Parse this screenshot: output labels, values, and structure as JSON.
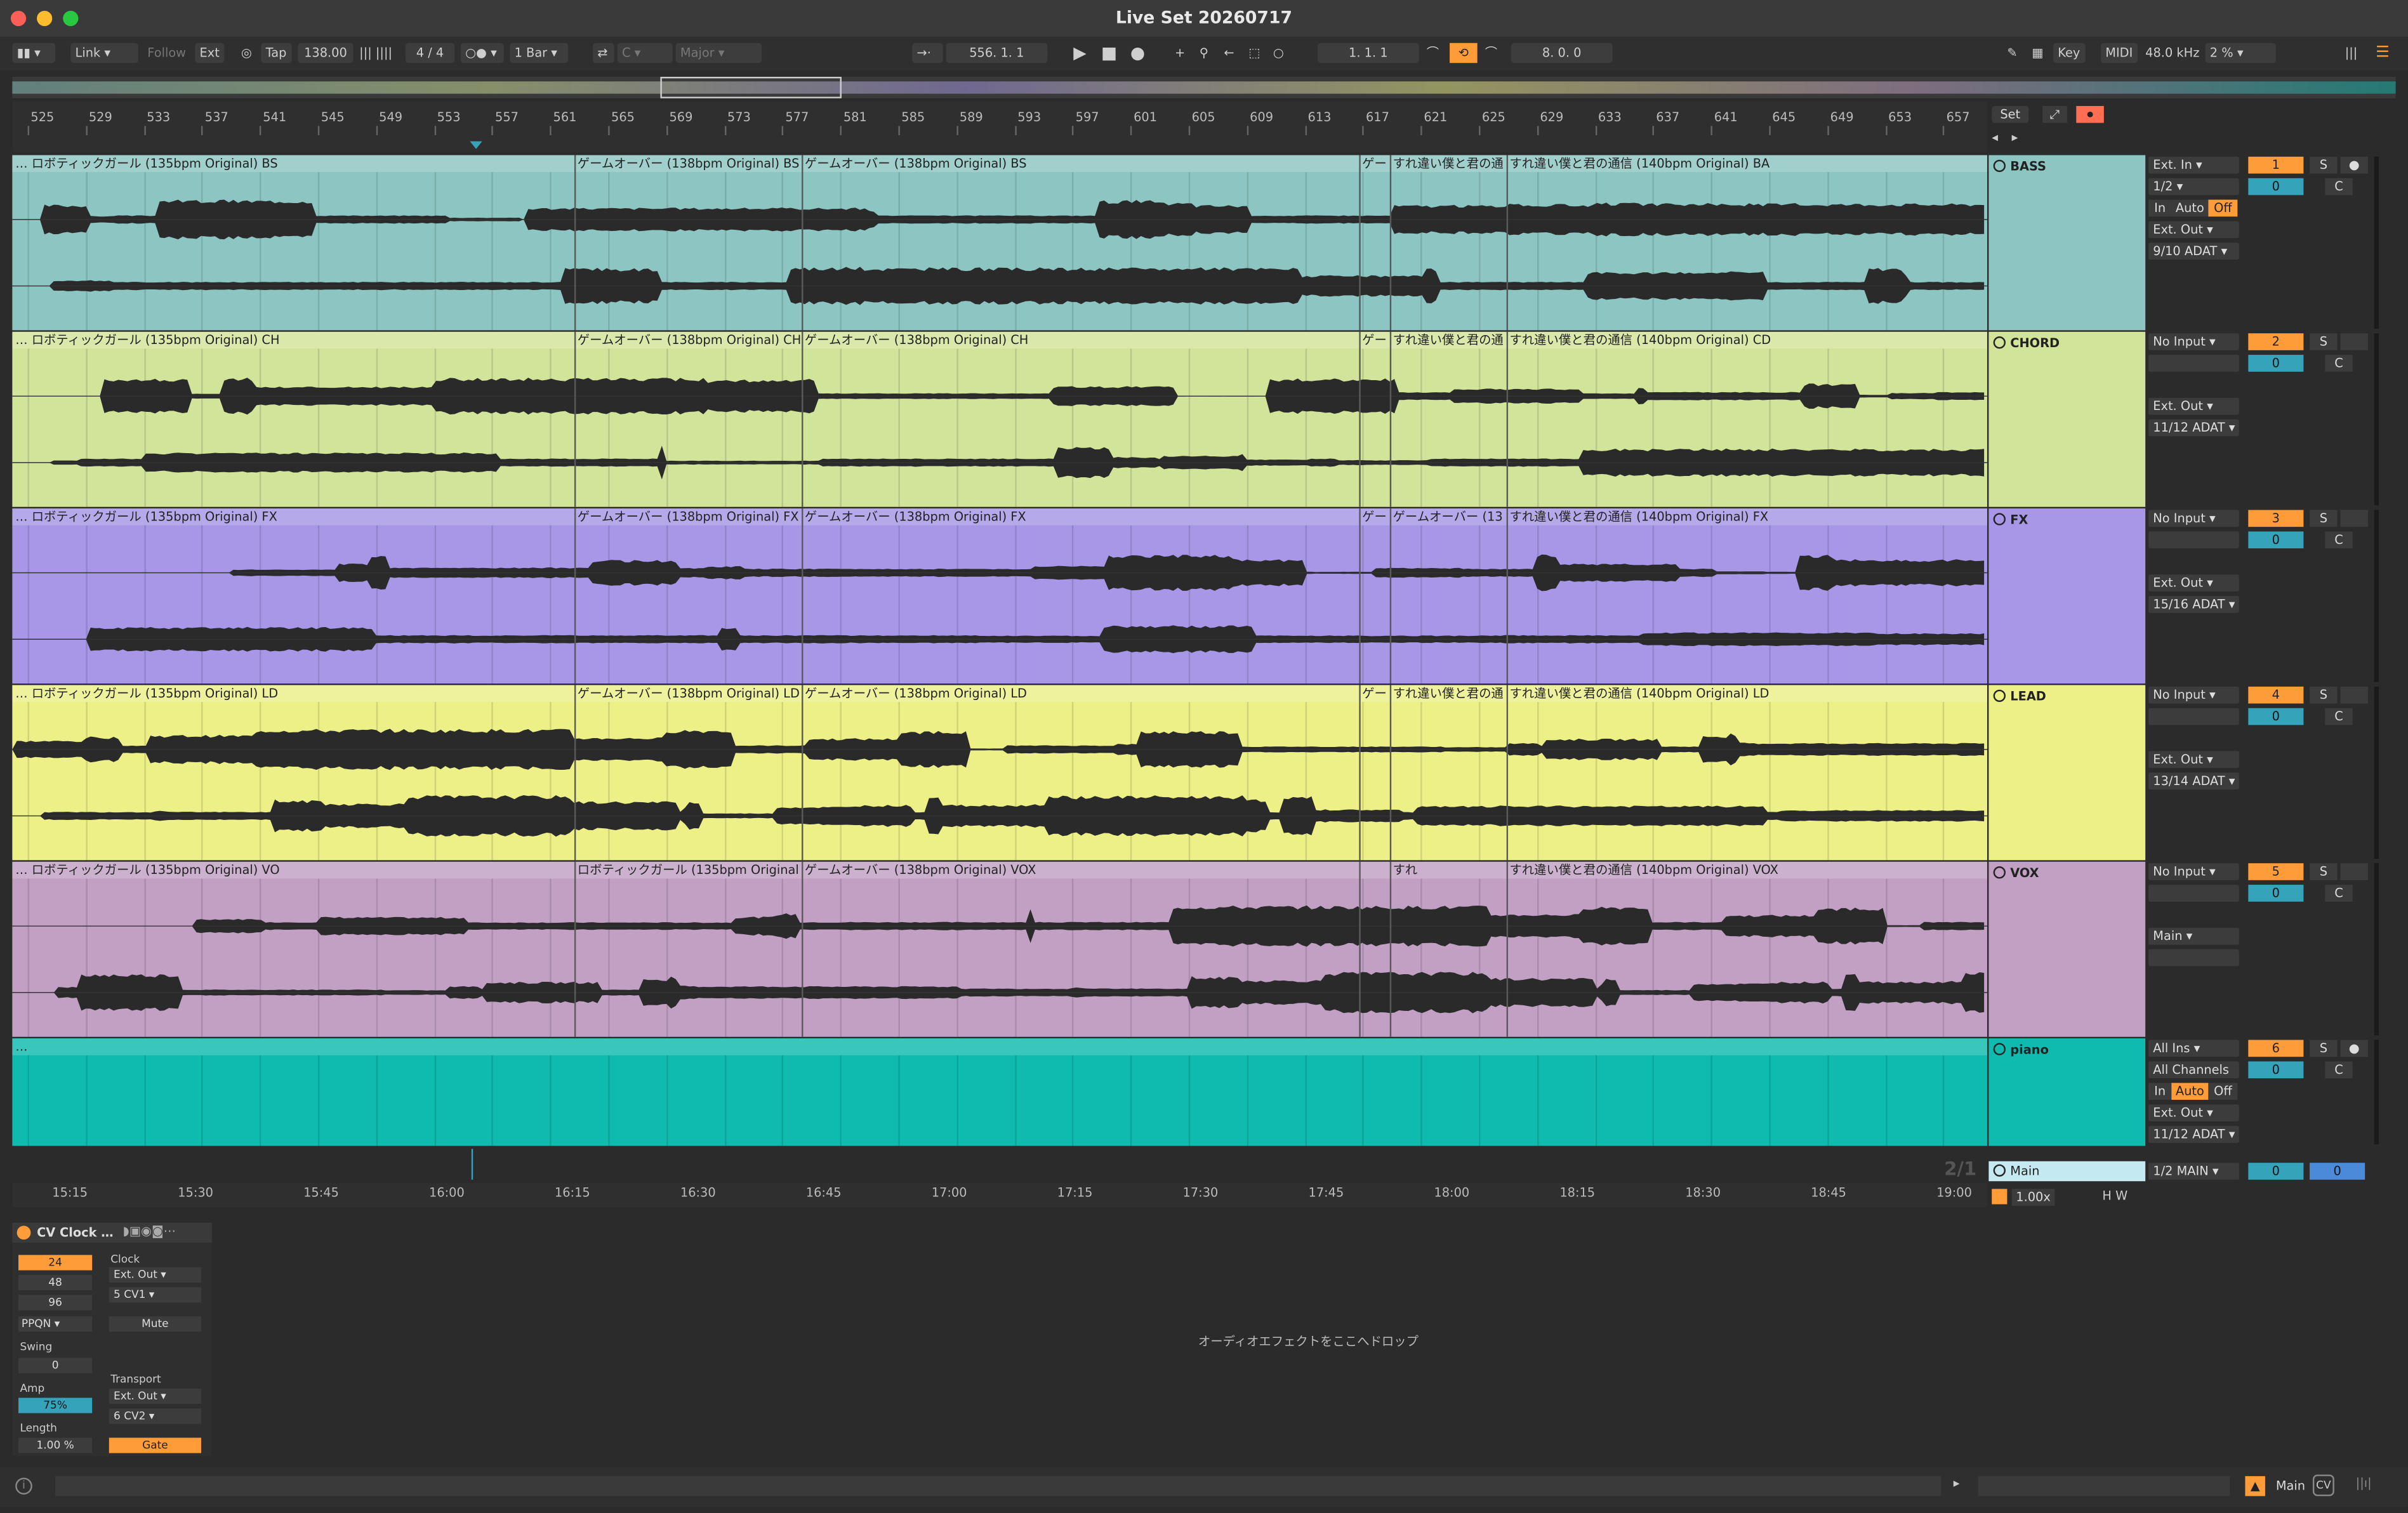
{
  "window": {
    "title": "Live Set 20260717"
  },
  "toolbar": {
    "link": "Link",
    "follow": "Follow",
    "ext": "Ext",
    "tap": "Tap",
    "tempo": "138.00",
    "signature": "4 / 4",
    "quantize": "1 Bar",
    "key": "C",
    "scale": "Major",
    "position": "556.  1.  1",
    "loop_start": "1.  1.  1",
    "loop_length": "8.  0.  0",
    "key_btn": "Key",
    "midi_btn": "MIDI",
    "sample_rate": "48.0 kHz",
    "cpu": "2 %"
  },
  "ruler": {
    "bars": [
      "525",
      "529",
      "533",
      "537",
      "541",
      "545",
      "549",
      "553",
      "557",
      "561",
      "565",
      "569",
      "573",
      "577",
      "581",
      "585",
      "589",
      "593",
      "597",
      "601",
      "605",
      "609",
      "613",
      "617",
      "621",
      "625",
      "629",
      "633",
      "637",
      "641",
      "645",
      "649",
      "653",
      "657"
    ],
    "set_btn": "Set"
  },
  "tracks": [
    {
      "name": "BASS",
      "color": "#8cc5c1",
      "num": "1",
      "vol": "0",
      "input": "Ext. In",
      "input_ch": "1/2",
      "monitor": [
        "In",
        "Auto",
        "Off"
      ],
      "output": "Ext. Out",
      "output_ch": "9/10 ADAT",
      "clips": [
        "… ロボティックガール (135bpm Original) BS",
        "ゲームオーバー (138bpm Original) BS",
        "ゲームオーバー (138bpm Original) BS",
        "ゲー",
        "すれ違い僕と君の通",
        "すれ違い僕と君の通信 (140bpm Original) BA"
      ]
    },
    {
      "name": "CHORD",
      "color": "#d2e39a",
      "num": "2",
      "vol": "0",
      "input": "No Input",
      "output": "Ext. Out",
      "output_ch": "11/12 ADAT",
      "clips": [
        "… ロボティックガール (135bpm Original) CH",
        "ゲームオーバー (138bpm Original) CH",
        "ゲームオーバー (138bpm Original) CH",
        "ゲー",
        "すれ違い僕と君の通",
        "すれ違い僕と君の通信 (140bpm Original) CD"
      ]
    },
    {
      "name": "FX",
      "color": "#a797e6",
      "num": "3",
      "vol": "0",
      "input": "No Input",
      "output": "Ext. Out",
      "output_ch": "15/16 ADAT",
      "clips": [
        "… ロボティックガール (135bpm Original) FX",
        "ゲームオーバー (138bpm Original) FX",
        "ゲームオーバー (138bpm Original) FX",
        "ゲー",
        "ゲームオーバー (13",
        "すれ違い僕と君の通信 (140bpm Original) FX"
      ]
    },
    {
      "name": "LEAD",
      "color": "#ecf087",
      "num": "4",
      "vol": "0",
      "input": "No Input",
      "output": "Ext. Out",
      "output_ch": "13/14 ADAT",
      "clips": [
        "… ロボティックガール (135bpm Original) LD",
        "ゲームオーバー (138bpm Original) LD",
        "ゲームオーバー (138bpm Original) LD",
        "ゲー",
        "すれ違い僕と君の通",
        "すれ違い僕と君の通信 (140bpm Original) LD"
      ]
    },
    {
      "name": "VOX",
      "color": "#c1a0c4",
      "num": "5",
      "vol": "0",
      "input": "No Input",
      "output": "Main",
      "output_ch": "",
      "clips": [
        "… ロボティックガール (135bpm Original) VO",
        "ロボティックガール (135bpm Original",
        "ゲームオーバー (138bpm Original) VOX",
        "",
        "すれ",
        "すれ違い僕と君の通信 (140bpm Original) VOX"
      ]
    },
    {
      "name": "piano",
      "color": "#0ebbae",
      "num": "6",
      "vol": "0",
      "input": "All Ins",
      "input_ch": "All Channels",
      "monitor": [
        "In",
        "Auto",
        "Off"
      ],
      "output": "Ext. Out",
      "output_ch": "11/12 ADAT",
      "clips": [
        "…"
      ]
    }
  ],
  "main": {
    "name": "Main",
    "zoom": "1.00x",
    "out": "1/2 MAIN",
    "vol": "0",
    "vol2": "0",
    "page": "2/1"
  },
  "timeline": [
    "15:15",
    "15:30",
    "15:45",
    "16:00",
    "16:15",
    "16:30",
    "16:45",
    "17:00",
    "17:15",
    "17:30",
    "17:45",
    "18:00",
    "18:15",
    "18:30",
    "18:45",
    "19:00"
  ],
  "device": {
    "name": "CV Clock …",
    "ppqn_values": [
      "24",
      "48",
      "96"
    ],
    "ppqn": "PPQN",
    "swing_label": "Swing",
    "swing": "0",
    "amp_label": "Amp",
    "amp": "75%",
    "length_label": "Length",
    "length": "1.00 %",
    "clock_label": "Clock",
    "clock_out": "Ext. Out",
    "clock_ch": "5 CV1",
    "mute": "Mute",
    "transport_label": "Transport",
    "transport_out": "Ext. Out",
    "transport_ch": "6 CV2",
    "gate": "Gate"
  },
  "drop_hint": "オーディオエフェクトをここへドロップ",
  "status": {
    "main_label": "Main",
    "cv_label": "CV"
  }
}
